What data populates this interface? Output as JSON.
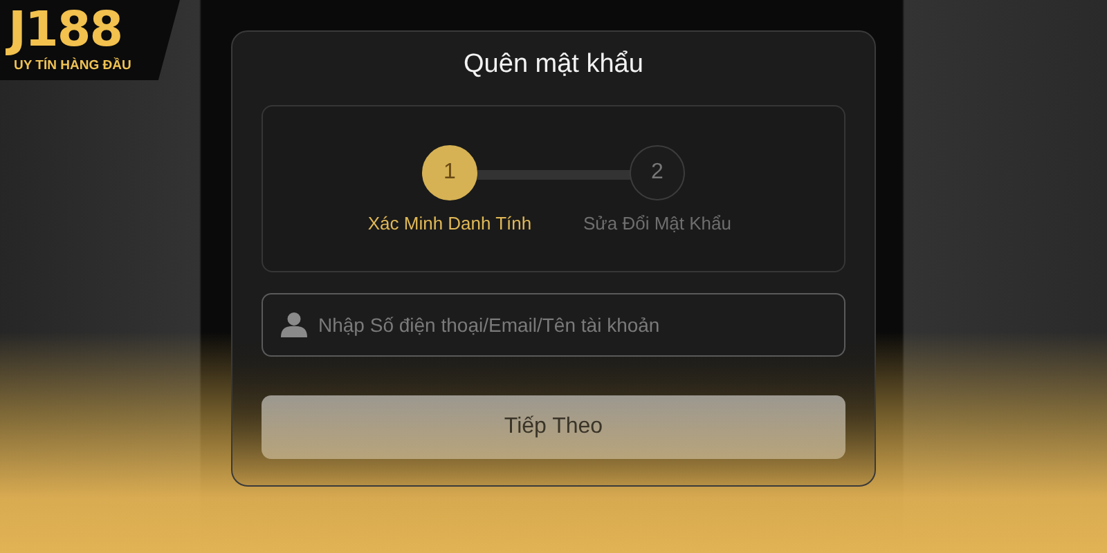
{
  "brand": {
    "name": "J188",
    "tagline": "UY TÍN HÀNG ĐẦU"
  },
  "title": "Quên mật khẩu",
  "steps": [
    {
      "number": "1",
      "label": "Xác Minh Danh Tính",
      "selected": true
    },
    {
      "number": "2",
      "label": "Sửa Đổi Mật Khẩu",
      "selected": false
    }
  ],
  "account_field": {
    "placeholder": "Nhập Số điện thoại/Email/Tên tài khoản"
  },
  "next_button": {
    "label": "Tiếp Theo"
  }
}
